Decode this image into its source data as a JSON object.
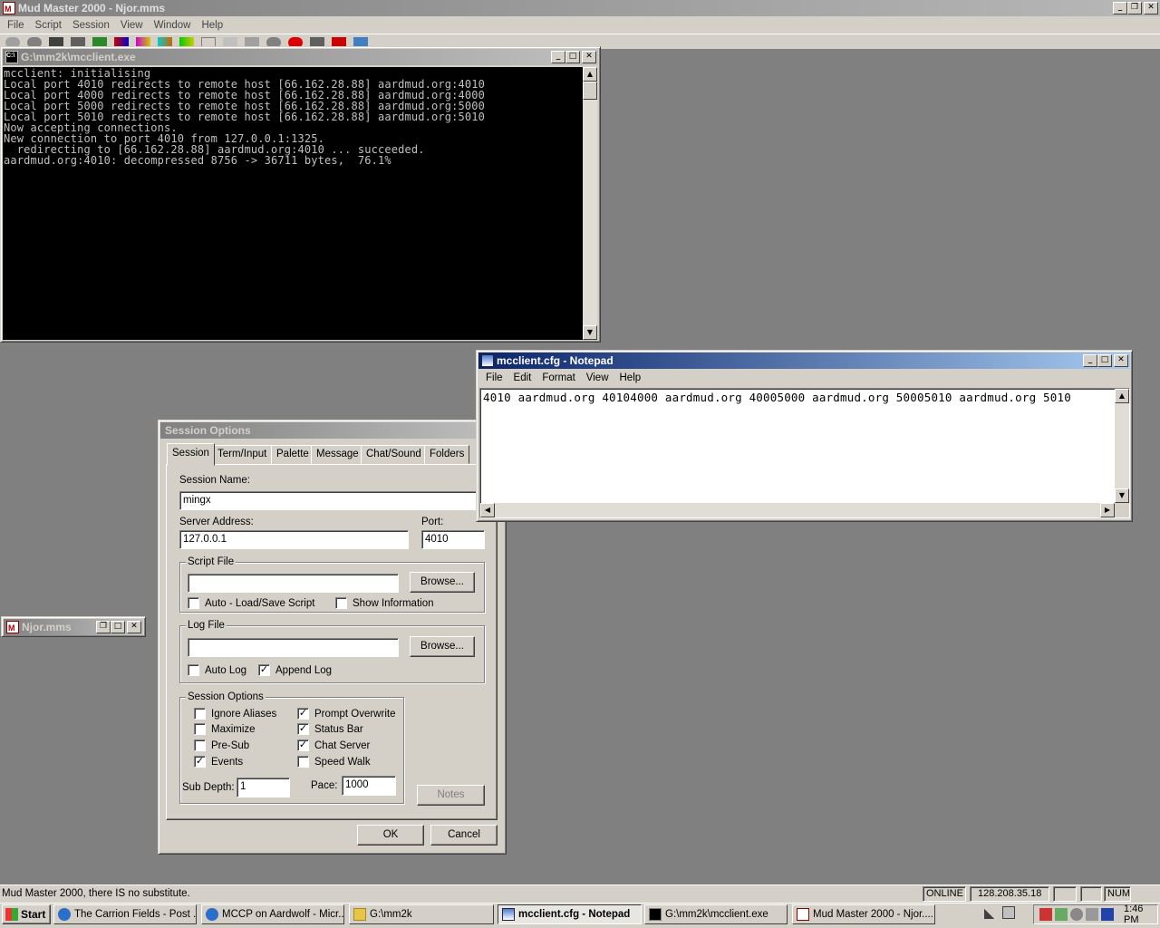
{
  "main": {
    "title": "Mud Master 2000 - Njor.mms",
    "menu": [
      "File",
      "Script",
      "Session",
      "View",
      "Window",
      "Help"
    ],
    "status_text": "Mud Master 2000, there IS no substitute.",
    "status_online": "ONLINE",
    "status_ip": "128.208.35.18",
    "status_num": "NUM"
  },
  "console": {
    "title": "G:\\mm2k\\mcclient.exe",
    "lines": [
      "mcclient: initialising",
      "Local port 4010 redirects to remote host [66.162.28.88] aardmud.org:4010",
      "Local port 4000 redirects to remote host [66.162.28.88] aardmud.org:4000",
      "Local port 5000 redirects to remote host [66.162.28.88] aardmud.org:5000",
      "Local port 5010 redirects to remote host [66.162.28.88] aardmud.org:5010",
      "Now accepting connections.",
      "New connection to port 4010 from 127.0.0.1:1325.",
      "  redirecting to [66.162.28.88] aardmud.org:4010 ... succeeded.",
      "aardmud.org:4010: decompressed 8756 -> 36711 bytes,  76.1%"
    ]
  },
  "notepad": {
    "title": "mcclient.cfg - Notepad",
    "menu": [
      "File",
      "Edit",
      "Format",
      "View",
      "Help"
    ],
    "content": "4010 aardmud.org 40104000 aardmud.org 40005000 aardmud.org 50005010 aardmud.org 5010"
  },
  "minimized": {
    "title": "Njor.mms"
  },
  "dialog": {
    "title": "Session Options",
    "tabs": [
      "Session",
      "Term/Input",
      "Palette",
      "Message",
      "Chat/Sound",
      "Folders"
    ],
    "session_name_label": "Session Name:",
    "session_name_value": "mingx",
    "server_address_label": "Server Address:",
    "server_address_value": "127.0.0.1",
    "port_label": "Port:",
    "port_value": "4010",
    "script_file_label": "Script File",
    "script_file_value": "",
    "browse_label": "Browse...",
    "auto_load_label": "Auto - Load/Save Script",
    "auto_load_checked": false,
    "show_info_label": "Show Information",
    "show_info_checked": false,
    "log_file_label": "Log File",
    "log_file_value": "",
    "auto_log_label": "Auto Log",
    "auto_log_checked": false,
    "append_log_label": "Append Log",
    "append_log_checked": true,
    "session_options_label": "Session Options",
    "options": [
      {
        "label": "Ignore Aliases",
        "checked": false
      },
      {
        "label": "Prompt Overwrite",
        "checked": true
      },
      {
        "label": "Maximize",
        "checked": false
      },
      {
        "label": "Status Bar",
        "checked": true
      },
      {
        "label": "Pre-Sub",
        "checked": false
      },
      {
        "label": "Chat Server",
        "checked": true
      },
      {
        "label": "Events",
        "checked": true
      },
      {
        "label": "Speed Walk",
        "checked": false
      }
    ],
    "sub_depth_label": "Sub Depth:",
    "sub_depth_value": "1",
    "pace_label": "Pace:",
    "pace_value": "1000",
    "notes_label": "Notes",
    "ok_label": "OK",
    "cancel_label": "Cancel"
  },
  "taskbar": {
    "start_label": "Start",
    "items": [
      {
        "label": "The Carrion Fields - Post ...",
        "icon": "ie-icon",
        "active": false
      },
      {
        "label": "MCCP on Aardwolf - Micr...",
        "icon": "ie-icon",
        "active": false
      },
      {
        "label": "G:\\mm2k",
        "icon": "folder-icon",
        "active": false
      },
      {
        "label": "mcclient.cfg - Notepad",
        "icon": "notepad-icon",
        "active": true
      },
      {
        "label": "G:\\mm2k\\mcclient.exe",
        "icon": "console-icon",
        "active": false
      },
      {
        "label": "Mud Master 2000 - Njor....",
        "icon": "mm2k-icon",
        "active": false
      }
    ],
    "clock": "1:46 PM"
  },
  "colors": {
    "title_active": "#0a246a",
    "title_inactive": "#808080",
    "workspace": "#808080",
    "face": "#d4d0c8",
    "console_bg": "#000000",
    "console_fg": "#c0c0c0"
  }
}
